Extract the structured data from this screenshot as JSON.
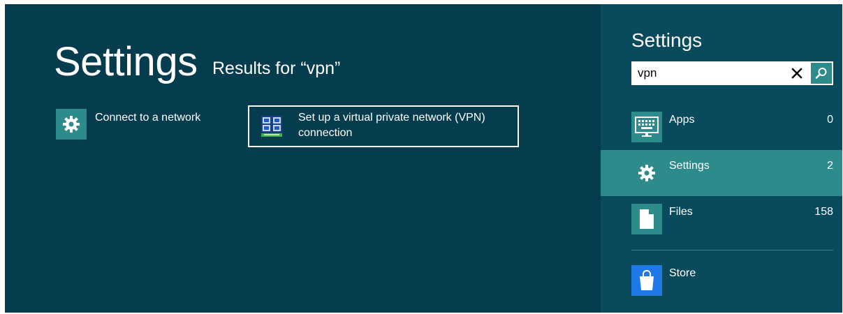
{
  "main": {
    "title": "Settings",
    "results_heading": "Results for “vpn”",
    "results": [
      {
        "label": "Connect to a network",
        "icon": "gear-icon"
      },
      {
        "label_line1": "Set up a virtual private network (VPN)",
        "label_line2": "connection",
        "icon": "vpn-network-icon"
      }
    ]
  },
  "pane": {
    "title": "Settings",
    "search": {
      "value": "vpn",
      "placeholder": ""
    },
    "scopes": [
      {
        "label": "Apps",
        "count": "0",
        "icon": "apps-keyboard-icon"
      },
      {
        "label": "Settings",
        "count": "2",
        "icon": "gear-icon",
        "selected": true
      },
      {
        "label": "Files",
        "count": "158",
        "icon": "file-icon"
      },
      {
        "label": "Store",
        "count": "",
        "icon": "store-bag-icon"
      }
    ]
  },
  "colors": {
    "background": "#053d4f",
    "pane_background": "#0a4a5d",
    "accent": "#2e8b8c",
    "store_accent": "#1e78e8",
    "text": "#ffffff"
  }
}
